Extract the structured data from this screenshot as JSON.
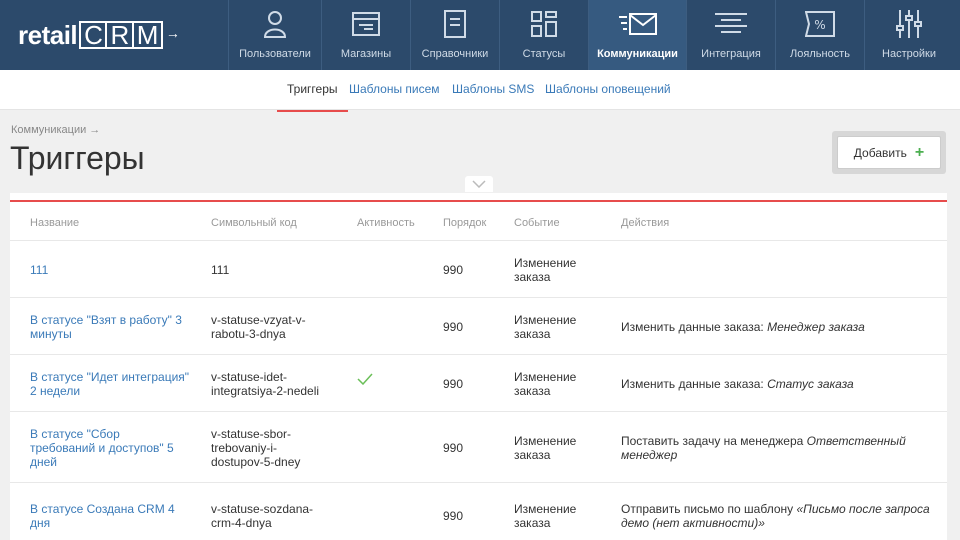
{
  "logo": {
    "retail": "retail",
    "crm_letters": [
      "C",
      "R",
      "M"
    ],
    "arrow": "→"
  },
  "nav": [
    {
      "label": "Пользователи",
      "icon": "user-icon"
    },
    {
      "label": "Магазины",
      "icon": "store-icon"
    },
    {
      "label": "Справочники",
      "icon": "document-icon"
    },
    {
      "label": "Статусы",
      "icon": "grid-icon"
    },
    {
      "label": "Коммуникации",
      "icon": "mail-icon",
      "active": true
    },
    {
      "label": "Интеграция",
      "icon": "integration-icon"
    },
    {
      "label": "Лояльность",
      "icon": "percent-icon"
    },
    {
      "label": "Настройки",
      "icon": "sliders-icon"
    }
  ],
  "subnav": [
    "Триггеры",
    "Шаблоны писем",
    "Шаблоны SMS",
    "Шаблоны оповещений"
  ],
  "breadcrumb": "Коммуникации →",
  "title": "Триггеры",
  "add_button": "Добавить",
  "add_icon": "+",
  "columns": [
    "Название",
    "Символьный код",
    "Активность",
    "Порядок",
    "Событие",
    "Действия"
  ],
  "rows": [
    {
      "name": "111",
      "code": "111",
      "active": false,
      "order": "990",
      "event": "Изменение заказа",
      "action": "",
      "action_em": ""
    },
    {
      "name": "В статусе \"Взят в работу\" 3 минуты",
      "code": "v-statuse-vzyat-v-rabotu-3-dnya",
      "active": false,
      "order": "990",
      "event": "Изменение заказа",
      "action": "Изменить данные заказа: ",
      "action_em": "Менеджер заказа"
    },
    {
      "name": "В статусе \"Идет интеграция\" 2 недели",
      "code": "v-statuse-idet-integratsiya-2-nedeli",
      "active": true,
      "order": "990",
      "event": "Изменение заказа",
      "action": "Изменить данные заказа: ",
      "action_em": "Статус заказа"
    },
    {
      "name": "В статусе \"Сбор требований и доступов\" 5 дней",
      "code": "v-statuse-sbor-trebovaniy-i-dostupov-5-dney",
      "active": false,
      "order": "990",
      "event": "Изменение заказа",
      "action": "Поставить задачу на менеджера ",
      "action_em": "Ответственный менеджер"
    },
    {
      "name": "В статусе Создана CRM 4 дня",
      "code": "v-statuse-sozdana-crm-4-dnya",
      "active": false,
      "order": "990",
      "event": "Изменение заказа",
      "action": "Отправить письмо по шаблону ",
      "action_em": "«Письмо после запроса демо (нет активности)»"
    }
  ],
  "colors": {
    "nav_bg": "#2c4a6b",
    "accent_red": "#e74c4c",
    "link": "#3a7ab8",
    "check": "#6bbf59"
  }
}
